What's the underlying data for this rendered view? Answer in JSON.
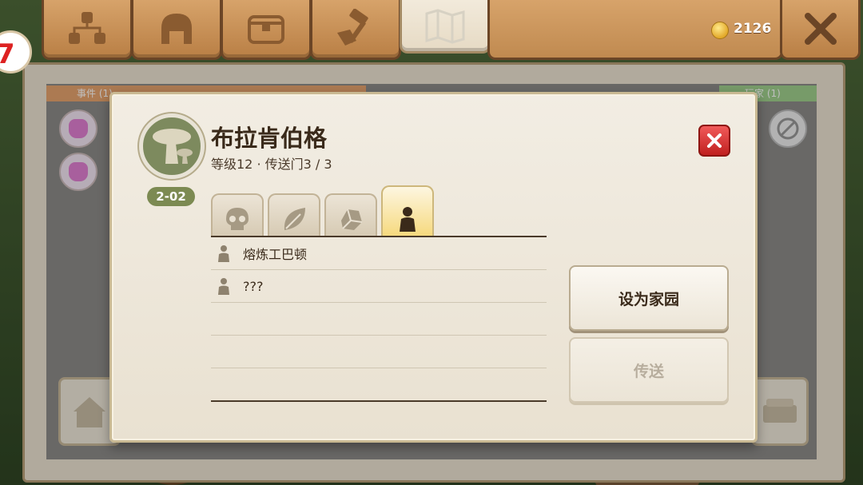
{
  "top_bar": {
    "tabs": [
      {
        "icon": "hierarchy-icon"
      },
      {
        "icon": "helmet-icon"
      },
      {
        "icon": "treasure-chest-icon"
      },
      {
        "icon": "crafting-hammer-icon"
      },
      {
        "icon": "map-icon",
        "active": true
      }
    ],
    "coins": "2126",
    "close_icon": "close-icon",
    "badge": "7"
  },
  "background_panel": {
    "left_strip_label": "事件 (1)",
    "right_strip_label": "玩家 (1)"
  },
  "modal": {
    "portrait_icon": "mushroom-icon",
    "level_badge": "2-02",
    "title": "布拉肯伯格",
    "subtitle": "等级12 · 传送门3 / 3",
    "close_icon": "close-icon",
    "category_tabs": [
      {
        "icon": "skull-icon"
      },
      {
        "icon": "leaf-icon"
      },
      {
        "icon": "ore-icon"
      },
      {
        "icon": "person-icon",
        "active": true
      }
    ],
    "rows": [
      {
        "icon": "person-icon",
        "label": "熔炼工巴顿"
      },
      {
        "icon": "person-icon",
        "label": "???"
      },
      {
        "label": ""
      },
      {
        "label": ""
      },
      {
        "label": ""
      }
    ],
    "buttons": {
      "set_home": "设为家园",
      "teleport": "传送"
    }
  },
  "colors": {
    "wood": "#c08a50",
    "parchment": "#efe9dd",
    "level_badge": "#7c8a52",
    "close_red": "#d82f2f",
    "active_tab": "#f6d97d"
  }
}
